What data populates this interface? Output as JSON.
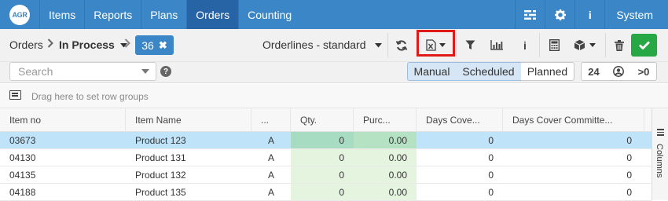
{
  "nav": {
    "logo": "AGR",
    "items": [
      "Items",
      "Reports",
      "Plans",
      "Orders",
      "Counting"
    ],
    "active": "Orders",
    "system": "System",
    "icons": [
      "list-icon",
      "gear-icon",
      "info-icon"
    ]
  },
  "toolbar": {
    "crumb_orders": "Orders",
    "crumb_status": "In Process",
    "badge_count": "36",
    "view": "Orderlines - standard",
    "buttons": [
      "refresh-icon",
      "excel-export-icon",
      "filter-icon",
      "bar-chart-icon",
      "info-icon",
      "calculator-icon",
      "box-icon",
      "trash-icon",
      "check-icon"
    ]
  },
  "search": {
    "placeholder": "Search",
    "help": "?",
    "segments": [
      "Manual",
      "Scheduled",
      "Planned"
    ],
    "active_segments": [
      "Manual",
      "Scheduled"
    ],
    "count_24": "24",
    "count_gt0": ">0"
  },
  "group": {
    "hint": "Drag here to set row groups"
  },
  "grid": {
    "columns": [
      "Item no",
      "Item Name",
      "...",
      "Qty.",
      "Purc...",
      "Days Cove...",
      "Days Cover Committe..."
    ],
    "rows": [
      {
        "item_no": "03673",
        "name": "Product 123",
        "flag": "A",
        "qty": "0",
        "purc": "0.00",
        "days": "0",
        "days_committed": "0",
        "selected": true
      },
      {
        "item_no": "04130",
        "name": "Product 131",
        "flag": "A",
        "qty": "0",
        "purc": "0.00",
        "days": "0",
        "days_committed": "0",
        "selected": false
      },
      {
        "item_no": "04135",
        "name": "Product 132",
        "flag": "A",
        "qty": "0",
        "purc": "0.00",
        "days": "0",
        "days_committed": "0",
        "selected": false
      },
      {
        "item_no": "04188",
        "name": "Product 135",
        "flag": "A",
        "qty": "0",
        "purc": "0.00",
        "days": "0",
        "days_committed": "0",
        "selected": false
      }
    ]
  },
  "side": {
    "columns_label": "Columns"
  },
  "colors": {
    "nav": "#3b86c7",
    "nav_active": "#2764a5",
    "selected_row": "#bfe3f8",
    "editable_cell": "#e5f4df",
    "highlight": "#e01919",
    "confirm": "#28a745"
  }
}
